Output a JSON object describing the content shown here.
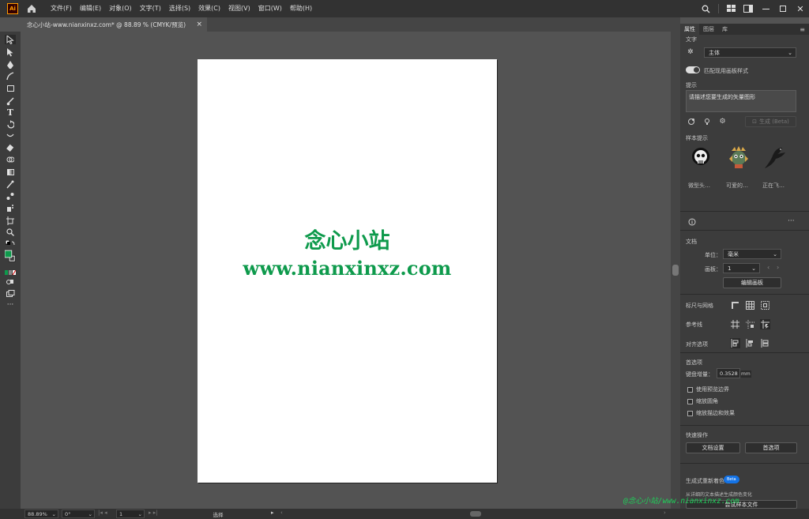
{
  "menubar": {
    "app_badge": "Ai",
    "items": [
      "文件(F)",
      "编辑(E)",
      "对象(O)",
      "文字(T)",
      "选择(S)",
      "效果(C)",
      "视图(V)",
      "窗口(W)",
      "帮助(H)"
    ]
  },
  "document_tab": {
    "title": "念心小站-www.nianxinxz.com* @ 88.89 % (CMYK/预览)",
    "close": "×"
  },
  "artboard": {
    "line1": "念心小站",
    "line2": "www.nianxinxz.com",
    "text_color": "#0e9a4c"
  },
  "panel": {
    "tabs": [
      "属性",
      "图层",
      "库"
    ],
    "text_section": "文字",
    "style_select": "主体",
    "match_toggle_label": "匹配现用画板样式",
    "prompt_label": "提示",
    "prompt_placeholder": "请描述您要生成的矢量图形",
    "generate_button": "生成 (Beta)",
    "sample_label": "样本提示",
    "samples": [
      "微型头…",
      "可爱的…",
      "正在飞…"
    ],
    "document_label": "文档",
    "unit_label": "单位：",
    "unit_value": "毫米",
    "artboard_label": "画板：",
    "artboard_value": "1",
    "edit_artboards_button": "编辑画板",
    "rulers_grids_label": "标尺与网格",
    "guides_label": "参考线",
    "align_options_label": "对齐选项",
    "preferences_label": "首选项",
    "keyboard_increment_label": "键盘增量：",
    "keyboard_increment_value": "0.3528",
    "keyboard_increment_unit": "mm",
    "check_preview_bounds": "使用预览边界",
    "check_scale_corners": "缩放圆角",
    "check_scale_strokes": "缩放描边和效果",
    "quick_actions_label": "快速操作",
    "doc_setup_button": "文档设置",
    "prefs_button": "首选项",
    "recolor_label": "生成式重新着色",
    "recolor_badge": "Beta",
    "recolor_desc": "从详细的文本描述生成颜色变化",
    "try_sample_button": "尝试样本文件"
  },
  "statusbar": {
    "zoom": "88.89%",
    "rotation": "0°",
    "artboard_nav": "1",
    "mode": "选择"
  },
  "watermark_footer": "@念心小站/www.nianxinxz.com"
}
